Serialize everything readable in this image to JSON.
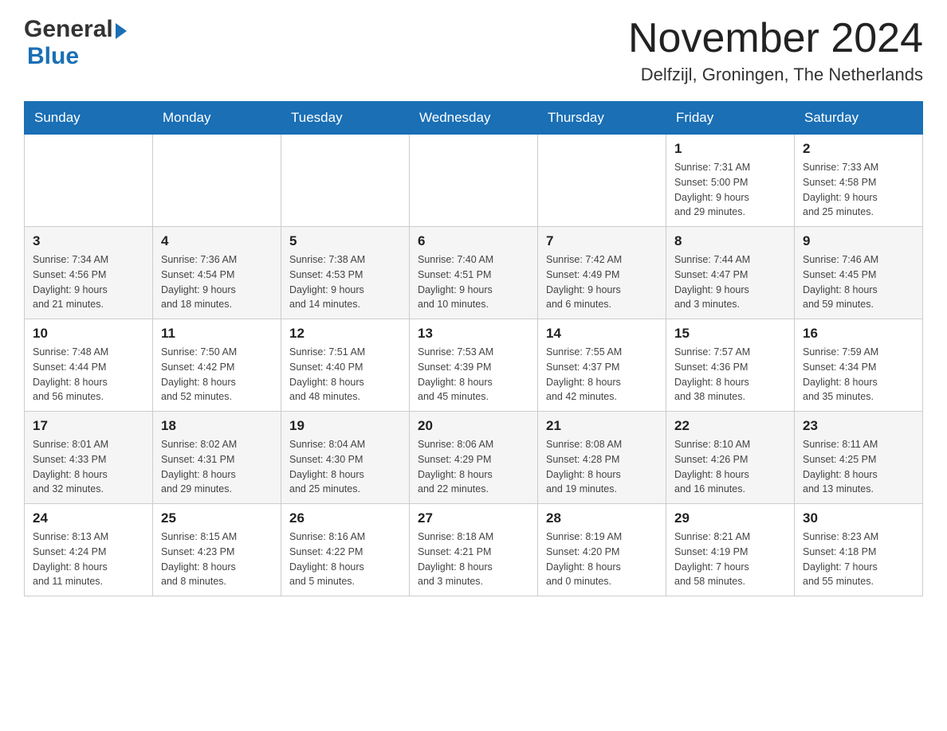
{
  "header": {
    "logo_general": "General",
    "logo_blue": "Blue",
    "month_title": "November 2024",
    "location": "Delfzijl, Groningen, The Netherlands"
  },
  "calendar": {
    "days_of_week": [
      "Sunday",
      "Monday",
      "Tuesday",
      "Wednesday",
      "Thursday",
      "Friday",
      "Saturday"
    ],
    "weeks": [
      [
        {
          "day": "",
          "info": ""
        },
        {
          "day": "",
          "info": ""
        },
        {
          "day": "",
          "info": ""
        },
        {
          "day": "",
          "info": ""
        },
        {
          "day": "",
          "info": ""
        },
        {
          "day": "1",
          "info": "Sunrise: 7:31 AM\nSunset: 5:00 PM\nDaylight: 9 hours\nand 29 minutes."
        },
        {
          "day": "2",
          "info": "Sunrise: 7:33 AM\nSunset: 4:58 PM\nDaylight: 9 hours\nand 25 minutes."
        }
      ],
      [
        {
          "day": "3",
          "info": "Sunrise: 7:34 AM\nSunset: 4:56 PM\nDaylight: 9 hours\nand 21 minutes."
        },
        {
          "day": "4",
          "info": "Sunrise: 7:36 AM\nSunset: 4:54 PM\nDaylight: 9 hours\nand 18 minutes."
        },
        {
          "day": "5",
          "info": "Sunrise: 7:38 AM\nSunset: 4:53 PM\nDaylight: 9 hours\nand 14 minutes."
        },
        {
          "day": "6",
          "info": "Sunrise: 7:40 AM\nSunset: 4:51 PM\nDaylight: 9 hours\nand 10 minutes."
        },
        {
          "day": "7",
          "info": "Sunrise: 7:42 AM\nSunset: 4:49 PM\nDaylight: 9 hours\nand 6 minutes."
        },
        {
          "day": "8",
          "info": "Sunrise: 7:44 AM\nSunset: 4:47 PM\nDaylight: 9 hours\nand 3 minutes."
        },
        {
          "day": "9",
          "info": "Sunrise: 7:46 AM\nSunset: 4:45 PM\nDaylight: 8 hours\nand 59 minutes."
        }
      ],
      [
        {
          "day": "10",
          "info": "Sunrise: 7:48 AM\nSunset: 4:44 PM\nDaylight: 8 hours\nand 56 minutes."
        },
        {
          "day": "11",
          "info": "Sunrise: 7:50 AM\nSunset: 4:42 PM\nDaylight: 8 hours\nand 52 minutes."
        },
        {
          "day": "12",
          "info": "Sunrise: 7:51 AM\nSunset: 4:40 PM\nDaylight: 8 hours\nand 48 minutes."
        },
        {
          "day": "13",
          "info": "Sunrise: 7:53 AM\nSunset: 4:39 PM\nDaylight: 8 hours\nand 45 minutes."
        },
        {
          "day": "14",
          "info": "Sunrise: 7:55 AM\nSunset: 4:37 PM\nDaylight: 8 hours\nand 42 minutes."
        },
        {
          "day": "15",
          "info": "Sunrise: 7:57 AM\nSunset: 4:36 PM\nDaylight: 8 hours\nand 38 minutes."
        },
        {
          "day": "16",
          "info": "Sunrise: 7:59 AM\nSunset: 4:34 PM\nDaylight: 8 hours\nand 35 minutes."
        }
      ],
      [
        {
          "day": "17",
          "info": "Sunrise: 8:01 AM\nSunset: 4:33 PM\nDaylight: 8 hours\nand 32 minutes."
        },
        {
          "day": "18",
          "info": "Sunrise: 8:02 AM\nSunset: 4:31 PM\nDaylight: 8 hours\nand 29 minutes."
        },
        {
          "day": "19",
          "info": "Sunrise: 8:04 AM\nSunset: 4:30 PM\nDaylight: 8 hours\nand 25 minutes."
        },
        {
          "day": "20",
          "info": "Sunrise: 8:06 AM\nSunset: 4:29 PM\nDaylight: 8 hours\nand 22 minutes."
        },
        {
          "day": "21",
          "info": "Sunrise: 8:08 AM\nSunset: 4:28 PM\nDaylight: 8 hours\nand 19 minutes."
        },
        {
          "day": "22",
          "info": "Sunrise: 8:10 AM\nSunset: 4:26 PM\nDaylight: 8 hours\nand 16 minutes."
        },
        {
          "day": "23",
          "info": "Sunrise: 8:11 AM\nSunset: 4:25 PM\nDaylight: 8 hours\nand 13 minutes."
        }
      ],
      [
        {
          "day": "24",
          "info": "Sunrise: 8:13 AM\nSunset: 4:24 PM\nDaylight: 8 hours\nand 11 minutes."
        },
        {
          "day": "25",
          "info": "Sunrise: 8:15 AM\nSunset: 4:23 PM\nDaylight: 8 hours\nand 8 minutes."
        },
        {
          "day": "26",
          "info": "Sunrise: 8:16 AM\nSunset: 4:22 PM\nDaylight: 8 hours\nand 5 minutes."
        },
        {
          "day": "27",
          "info": "Sunrise: 8:18 AM\nSunset: 4:21 PM\nDaylight: 8 hours\nand 3 minutes."
        },
        {
          "day": "28",
          "info": "Sunrise: 8:19 AM\nSunset: 4:20 PM\nDaylight: 8 hours\nand 0 minutes."
        },
        {
          "day": "29",
          "info": "Sunrise: 8:21 AM\nSunset: 4:19 PM\nDaylight: 7 hours\nand 58 minutes."
        },
        {
          "day": "30",
          "info": "Sunrise: 8:23 AM\nSunset: 4:18 PM\nDaylight: 7 hours\nand 55 minutes."
        }
      ]
    ]
  }
}
